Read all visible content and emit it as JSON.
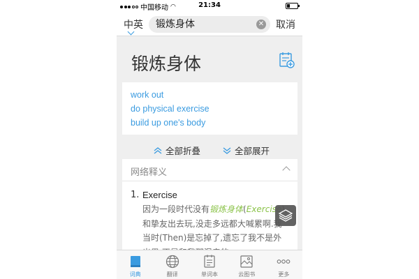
{
  "status_bar": {
    "carrier": "中国移动",
    "time": "21:34"
  },
  "search": {
    "lang_toggle": "中英",
    "query": "锻炼身体",
    "cancel_label": "取消"
  },
  "entry": {
    "headword": "锻炼身体",
    "translations": [
      "work out",
      "do physical exercise",
      "build up one's body"
    ]
  },
  "toggles": {
    "collapse_all": "全部折叠",
    "expand_all": "全部展开"
  },
  "web_definitions": {
    "title": "网络释义",
    "items": [
      {
        "number": "1.",
        "term": "Exercise",
        "example_part1": "因为一段时代没有",
        "example_hl1": "锻炼身体",
        "example_part2": "(",
        "example_hl2": "Exercise",
        "example_part3": "),和挚友出去玩,没走多远都大喊累啊.我当时(Then)是忘掉了,遗忘了我不是外出男,不是和我那混亲的"
      }
    ]
  },
  "tabbar": {
    "tabs": [
      {
        "label": "词典",
        "icon": "book-icon",
        "active": true
      },
      {
        "label": "翻译",
        "icon": "globe-icon",
        "active": false
      },
      {
        "label": "单词本",
        "icon": "notebook-icon",
        "active": false
      },
      {
        "label": "云图书",
        "icon": "cloud-book-icon",
        "active": false
      },
      {
        "label": "更多",
        "icon": "more-icon",
        "active": false
      }
    ]
  },
  "colors": {
    "accent": "#3a9be0",
    "highlight": "#8bc34a",
    "background": "#efefef"
  }
}
